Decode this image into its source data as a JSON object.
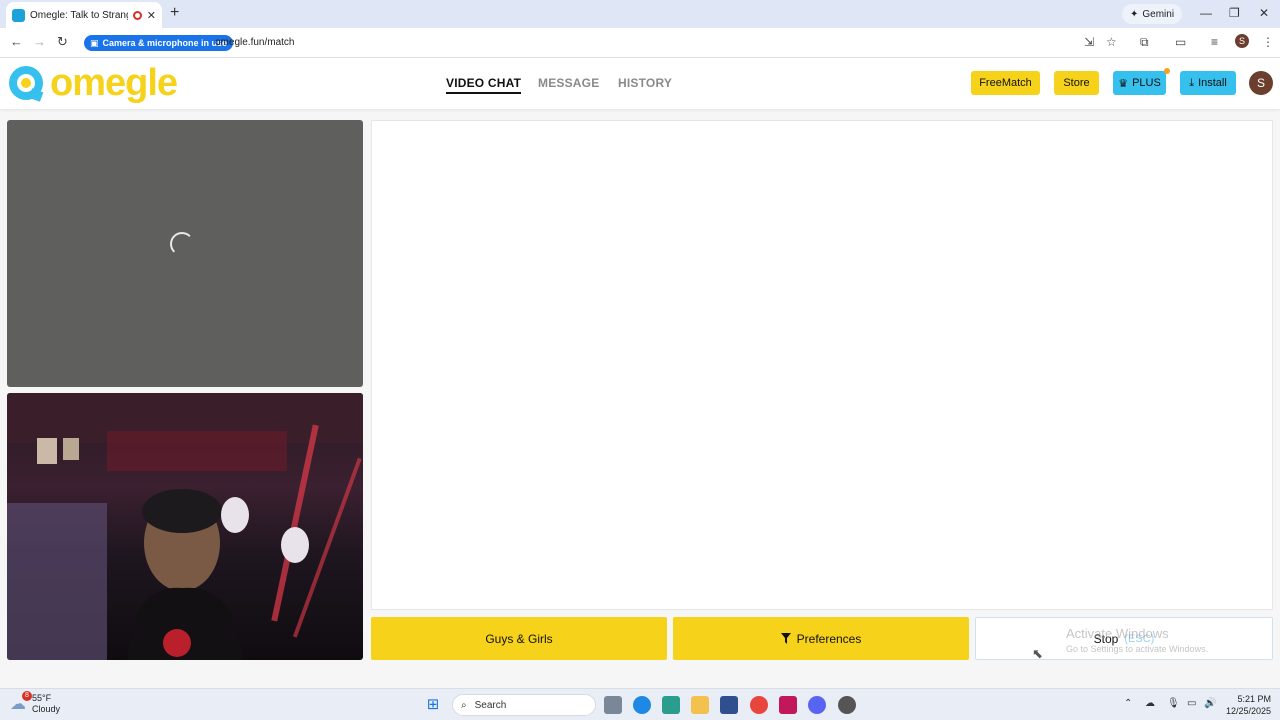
{
  "browser": {
    "tab_title": "Omegle: Talk to Strangers w",
    "new_tab_symbol": "+",
    "gemini_label": "Gemini",
    "camera_chip": "Camera & microphone in use",
    "url": "omegle.fun/match"
  },
  "site": {
    "logo_text": "omegle",
    "nav": [
      "VIDEO CHAT",
      "MESSAGE",
      "HISTORY"
    ],
    "buttons": {
      "freematch": "FreeMatch",
      "store": "Store",
      "plus": "PLUS",
      "install": "Install"
    },
    "avatar_letter": "S"
  },
  "controls": {
    "gender_filter": "Guys & Girls",
    "preferences": "Preferences",
    "stop": "Stop",
    "stop_hint": "(ESC)"
  },
  "overlay": {
    "activate_title": "Activate Windows",
    "activate_sub": "Go to Settings to activate Windows."
  },
  "taskbar": {
    "temperature": "55°F",
    "condition": "Cloudy",
    "weather_badge": "8",
    "search_placeholder": "Search",
    "time": "5:21 PM",
    "date": "12/25/2025"
  },
  "colors": {
    "brand_yellow": "#f7d21a",
    "brand_blue": "#35c0ee",
    "video_placeholder": "#5f5f5d"
  }
}
